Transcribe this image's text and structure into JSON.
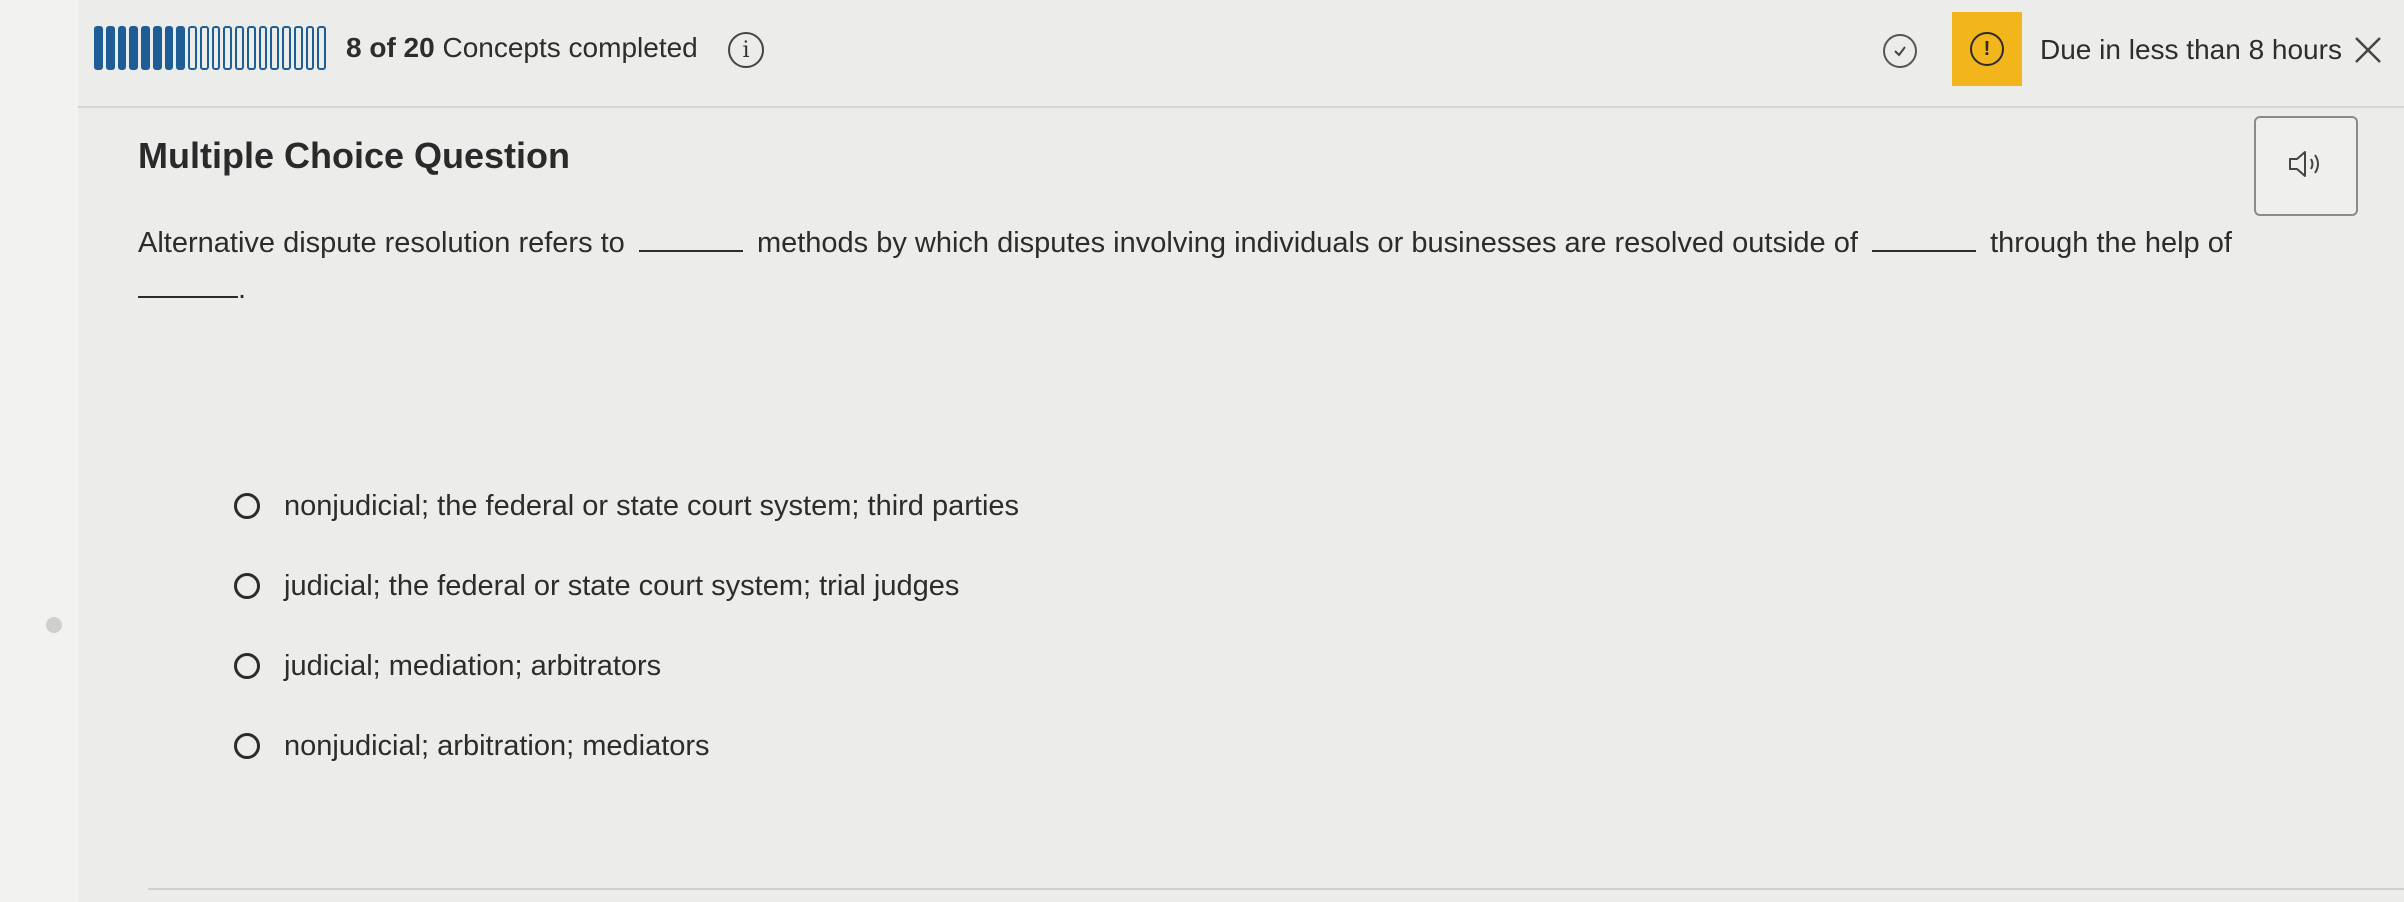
{
  "header": {
    "progress": {
      "completed": 8,
      "total": 20
    },
    "progress_count": "8 of 20",
    "progress_suffix": "Concepts completed",
    "due_text": "Due in less than 8 hours"
  },
  "question": {
    "type_label": "Multiple Choice Question",
    "text_parts": [
      "Alternative dispute resolution refers to",
      "methods by which disputes involving individuals or businesses are resolved outside of",
      "through the help of",
      "."
    ]
  },
  "options": [
    {
      "label": "nonjudicial; the federal or state court system; third parties"
    },
    {
      "label": "judicial; the federal or state court system; trial judges"
    },
    {
      "label": "judicial; mediation; arbitrators"
    },
    {
      "label": "nonjudicial; arbitration; mediators"
    }
  ],
  "icons": {
    "info": "info-icon",
    "check": "check-circle-icon",
    "alert": "exclamation-icon",
    "close": "close-icon",
    "audio": "speaker-icon"
  },
  "colors": {
    "progress_blue": "#1f5d96",
    "alert_yellow": "#f3b51c"
  }
}
